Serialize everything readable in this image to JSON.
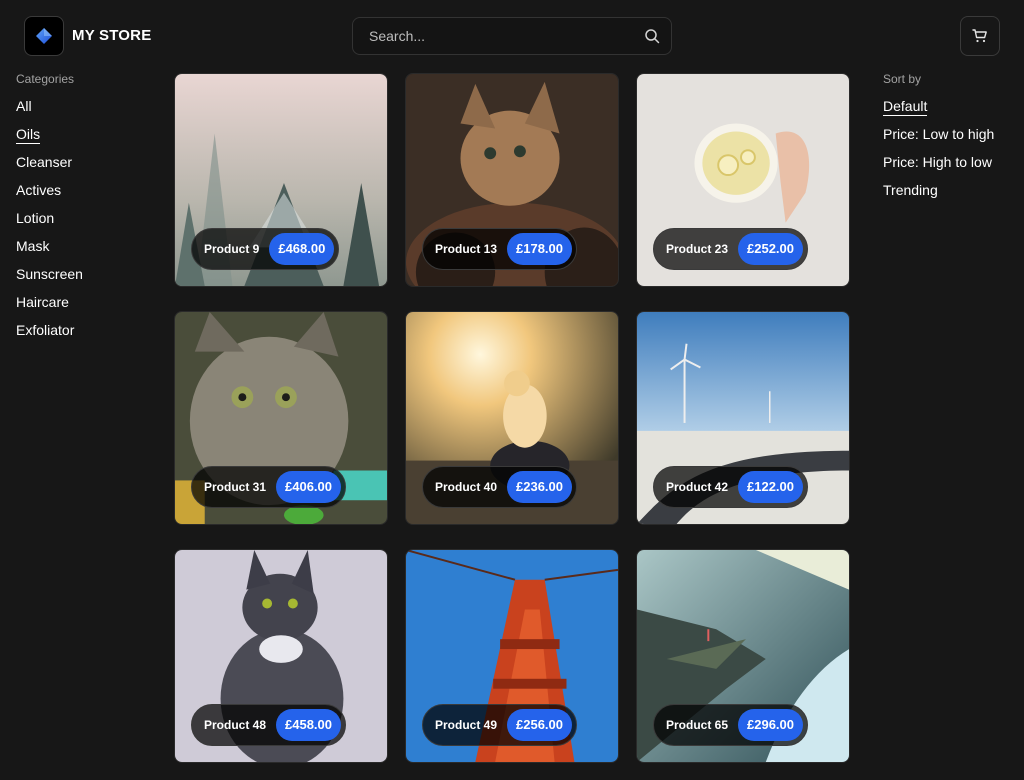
{
  "header": {
    "brand": "MY STORE",
    "search_placeholder": "Search..."
  },
  "categories": {
    "title": "Categories",
    "items": [
      "All",
      "Oils",
      "Cleanser",
      "Actives",
      "Lotion",
      "Mask",
      "Sunscreen",
      "Haircare",
      "Exfoliator"
    ],
    "active": "Oils"
  },
  "sort": {
    "title": "Sort by",
    "items": [
      "Default",
      "Price: Low to high",
      "Price: High to low",
      "Trending"
    ],
    "active": "Default"
  },
  "products": [
    {
      "name": "Product 9",
      "price": "£468.00",
      "image": "snowy pine trees in fog"
    },
    {
      "name": "Product 13",
      "price": "£178.00",
      "image": "kitten in armor"
    },
    {
      "name": "Product 23",
      "price": "£252.00",
      "image": "hand holding cup of lemon tea"
    },
    {
      "name": "Product 31",
      "price": "£406.00",
      "image": "tabby kitten"
    },
    {
      "name": "Product 40",
      "price": "£236.00",
      "image": "girl sitting at sunset"
    },
    {
      "name": "Product 42",
      "price": "£122.00",
      "image": "winding road with wind turbines"
    },
    {
      "name": "Product 48",
      "price": "£458.00",
      "image": "painting of fluffy grey cat"
    },
    {
      "name": "Product 49",
      "price": "£256.00",
      "image": "red suspension bridge tower"
    },
    {
      "name": "Product 65",
      "price": "£296.00",
      "image": "person on cliff over fjord"
    }
  ],
  "icons": {
    "logo": "diamond-logo-icon",
    "search": "search-icon",
    "cart": "cart-icon"
  },
  "colors": {
    "background": "#171717",
    "accent": "#2563eb",
    "logo_blue": "#3b82f6"
  }
}
